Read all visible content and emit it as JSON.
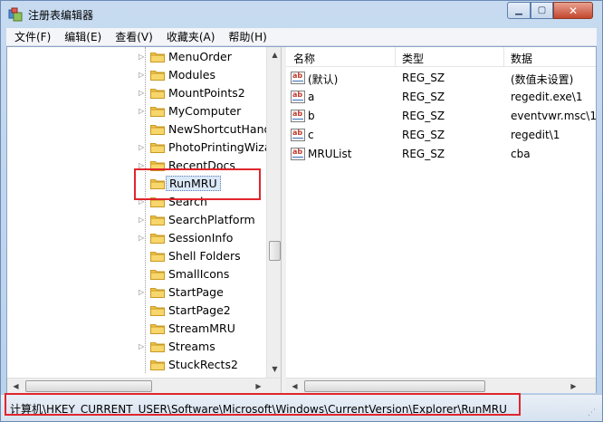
{
  "window": {
    "title": "注册表编辑器"
  },
  "menu": [
    "文件(F)",
    "编辑(E)",
    "查看(V)",
    "收藏夹(A)",
    "帮助(H)"
  ],
  "tree": {
    "items": [
      {
        "label": "MenuOrder",
        "expandable": true
      },
      {
        "label": "Modules",
        "expandable": true
      },
      {
        "label": "MountPoints2",
        "expandable": true
      },
      {
        "label": "MyComputer",
        "expandable": true
      },
      {
        "label": "NewShortcutHand",
        "expandable": false
      },
      {
        "label": "PhotoPrintingWiza",
        "expandable": true
      },
      {
        "label": "RecentDocs",
        "expandable": true
      },
      {
        "label": "RunMRU",
        "expandable": false,
        "selected": true
      },
      {
        "label": "Search",
        "expandable": true
      },
      {
        "label": "SearchPlatform",
        "expandable": true
      },
      {
        "label": "SessionInfo",
        "expandable": true
      },
      {
        "label": "Shell Folders",
        "expandable": false
      },
      {
        "label": "SmallIcons",
        "expandable": false
      },
      {
        "label": "StartPage",
        "expandable": true
      },
      {
        "label": "StartPage2",
        "expandable": false
      },
      {
        "label": "StreamMRU",
        "expandable": false
      },
      {
        "label": "Streams",
        "expandable": true
      },
      {
        "label": "StuckRects2",
        "expandable": false
      }
    ]
  },
  "list": {
    "columns": [
      "名称",
      "类型",
      "数据"
    ],
    "rows": [
      {
        "name": "(默认)",
        "type": "REG_SZ",
        "data": "(数值未设置)"
      },
      {
        "name": "a",
        "type": "REG_SZ",
        "data": "regedit.exe\\1"
      },
      {
        "name": "b",
        "type": "REG_SZ",
        "data": "eventvwr.msc\\1"
      },
      {
        "name": "c",
        "type": "REG_SZ",
        "data": "regedit\\1"
      },
      {
        "name": "MRUList",
        "type": "REG_SZ",
        "data": "cba"
      }
    ]
  },
  "status": {
    "path": "计算机\\HKEY_CURRENT_USER\\Software\\Microsoft\\Windows\\CurrentVersion\\Explorer\\RunMRU"
  },
  "colors": {
    "highlight": "#e0262c",
    "folder": "#f2c64b",
    "selection": "#dbe8f8"
  },
  "icons": {
    "folder": "folder-icon",
    "string_value": "string-value-icon",
    "app": "regedit-icon"
  }
}
